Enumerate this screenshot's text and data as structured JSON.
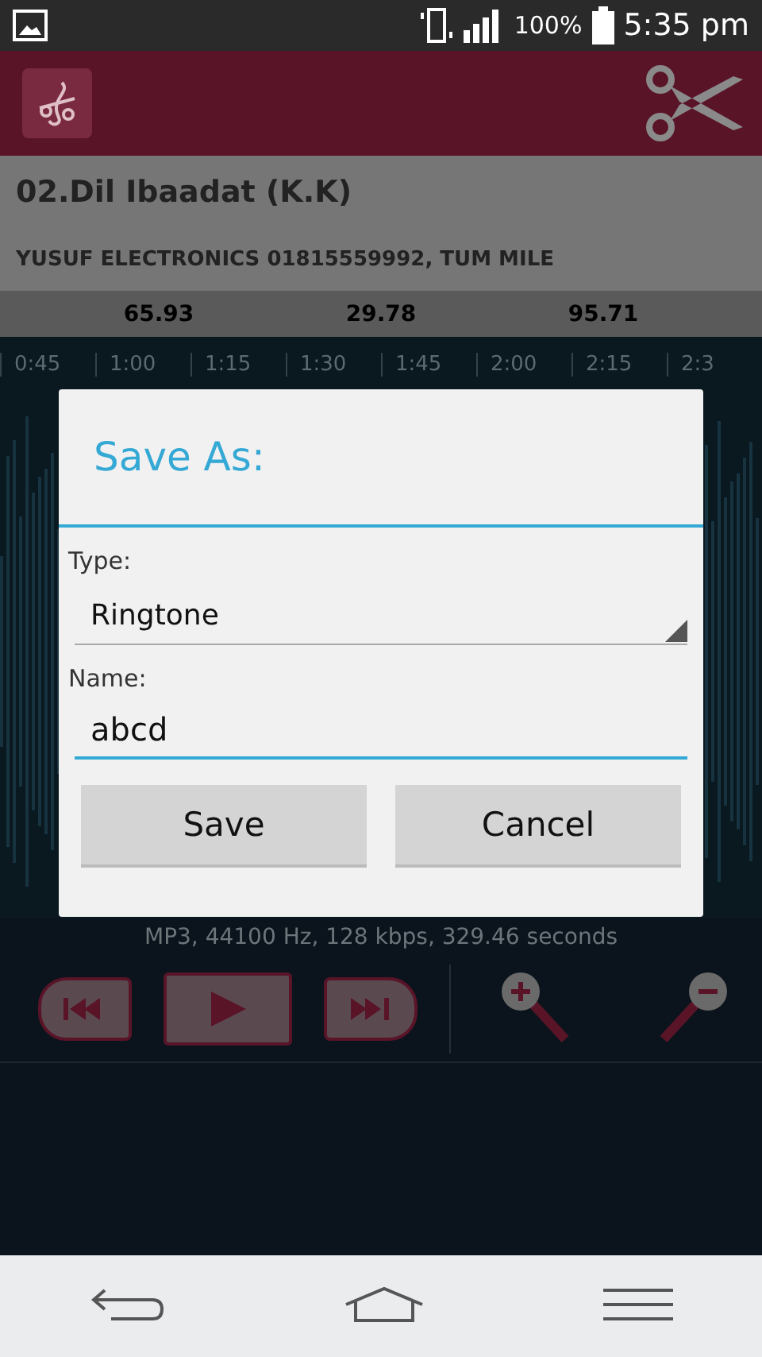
{
  "status_bar": {
    "battery": "100%",
    "time": "5:35 pm"
  },
  "song": {
    "title": "02.Dil Ibaadat (K.K)",
    "artist": "YUSUF ELECTRONICS 01815559992, TUM MILE"
  },
  "markers": [
    "65.93",
    "29.78",
    "95.71"
  ],
  "timeline": [
    "0:45",
    "1:00",
    "1:15",
    "1:30",
    "1:45",
    "2:00",
    "2:15",
    "2:3"
  ],
  "file_info": "MP3, 44100 Hz, 128 kbps, 329.46 seconds",
  "dialog": {
    "title": "Save As:",
    "type_label": "Type:",
    "type_value": "Ringtone",
    "name_label": "Name:",
    "name_value": "abcd",
    "buttons": [
      "Save",
      "Cancel"
    ]
  }
}
